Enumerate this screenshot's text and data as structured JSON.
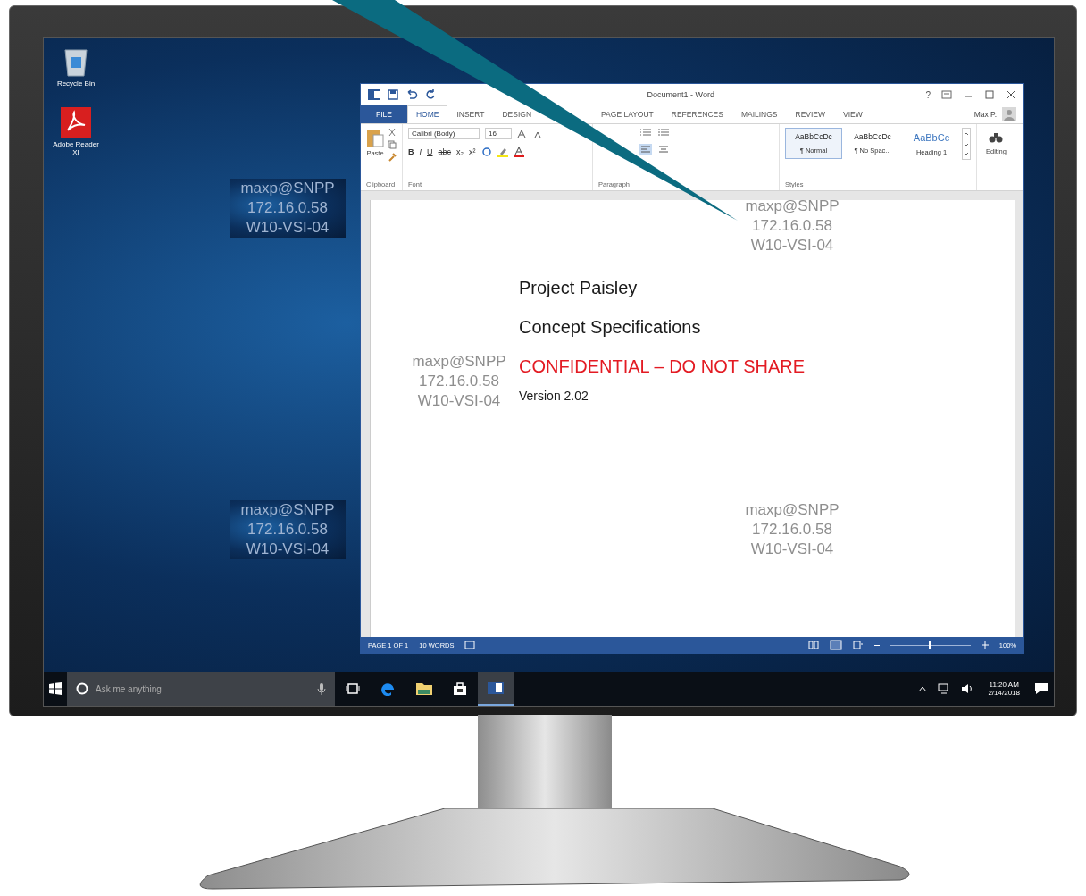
{
  "desktop_icons": [
    {
      "label": "Recycle Bin",
      "kind": "recycle"
    },
    {
      "label": "Adobe Reader XI",
      "kind": "pdf"
    }
  ],
  "watermarks": [
    {
      "user": "maxp@SNPP",
      "ip": "172.16.0.58",
      "host": "W10-VSI-04",
      "kind": "desktop"
    },
    {
      "user": "maxp@SNPP",
      "ip": "172.16.0.58",
      "host": "W10-VSI-04",
      "kind": "document"
    },
    {
      "user": "maxp@SNPP",
      "ip": "172.16.0.58",
      "host": "W10-VSI-04",
      "kind": "document"
    },
    {
      "user": "maxp@SNPP",
      "ip": "172.16.0.58",
      "host": "W10-VSI-04",
      "kind": "desktop"
    },
    {
      "user": "maxp@SNPP",
      "ip": "172.16.0.58",
      "host": "W10-VSI-04",
      "kind": "document"
    }
  ],
  "word": {
    "title": "Document1 - Word",
    "help": "?",
    "user": "Max P.",
    "tabs": [
      {
        "label": "FILE",
        "kind": "file",
        "selected": false
      },
      {
        "label": "HOME",
        "kind": "tab",
        "selected": true
      },
      {
        "label": "INSERT",
        "kind": "tab",
        "selected": false
      },
      {
        "label": "DESIGN",
        "kind": "tab",
        "selected": false
      },
      {
        "label": "PAGE LAYOUT",
        "kind": "tab",
        "selected": false
      },
      {
        "label": "REFERENCES",
        "kind": "tab",
        "selected": false
      },
      {
        "label": "MAILINGS",
        "kind": "tab",
        "selected": false
      },
      {
        "label": "REVIEW",
        "kind": "tab",
        "selected": false
      },
      {
        "label": "VIEW",
        "kind": "tab",
        "selected": false
      }
    ],
    "ribbon": {
      "paste": "Paste",
      "font_name": "Calibri (Body)",
      "font_size": "16",
      "format_buttons": [
        "B",
        "I",
        "U",
        "abc",
        "x₂",
        "x²"
      ],
      "styles": [
        {
          "sample": "AaBbCcDc",
          "name": "¶ Normal",
          "kind": "body",
          "selected": true
        },
        {
          "sample": "AaBbCcDc",
          "name": "¶ No Spac...",
          "kind": "body",
          "selected": false
        },
        {
          "sample": "AaBbCc",
          "name": "Heading 1",
          "kind": "heading",
          "selected": false
        }
      ],
      "editing": "Editing",
      "groups": [
        "Clipboard",
        "Font",
        "Paragraph",
        "Styles"
      ]
    },
    "document": [
      {
        "text": "Project Paisley",
        "kind": "heading"
      },
      {
        "text": "Concept Specifications",
        "kind": "heading"
      },
      {
        "text": "CONFIDENTIAL – DO NOT SHARE",
        "kind": "warning"
      },
      {
        "text": "Version 2.02",
        "kind": "body"
      }
    ],
    "status_bar": {
      "page": "PAGE 1 OF 1",
      "words": "10 WORDS",
      "zoom": "100%",
      "level": 0.5
    }
  },
  "taskbar": {
    "search_placeholder": "Ask me anything",
    "apps": [
      {
        "kind": "taskview",
        "selected": false
      },
      {
        "kind": "edge",
        "selected": false
      },
      {
        "kind": "folder",
        "selected": false
      },
      {
        "kind": "store",
        "selected": false
      },
      {
        "kind": "word",
        "selected": true
      }
    ],
    "time": "11:20 AM",
    "date": "2/14/2018"
  }
}
